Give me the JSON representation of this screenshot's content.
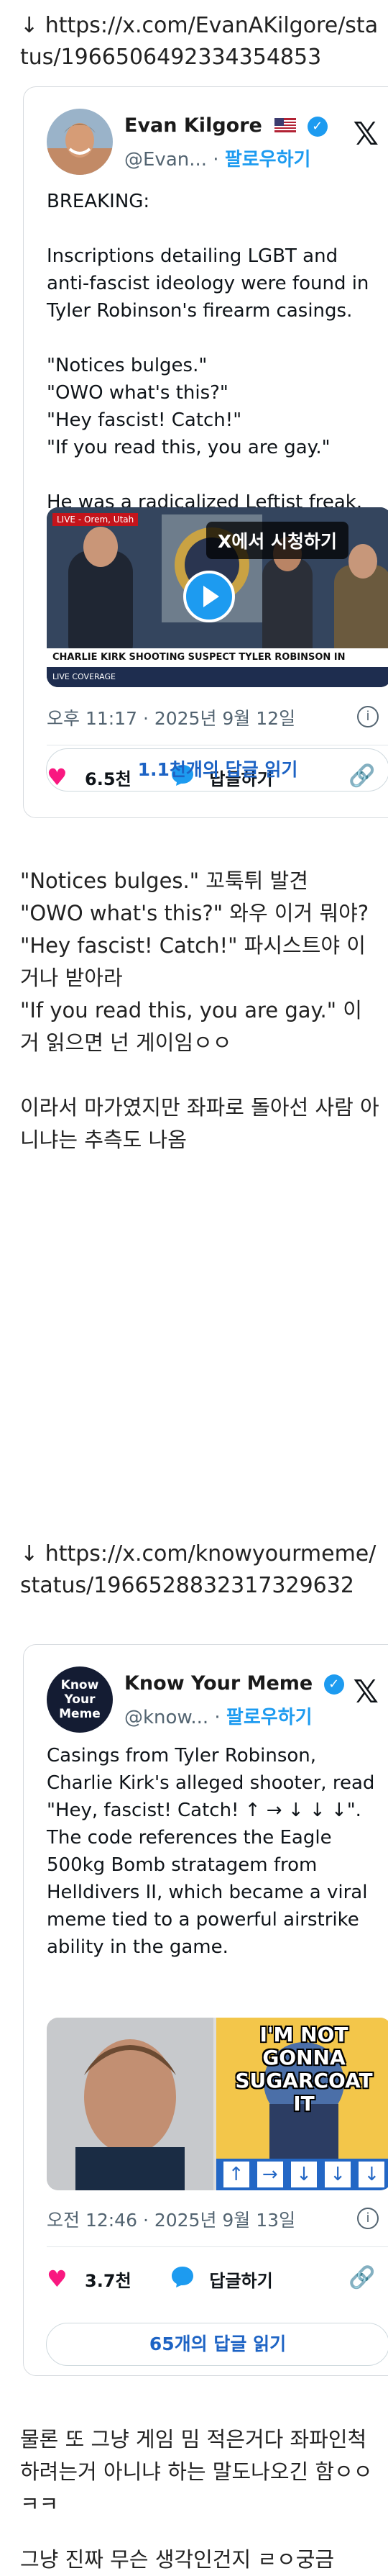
{
  "post1": {
    "link_arrow": "↓",
    "link_url": "https://x.com/EvanAKilgore/status/1966506492334354853",
    "tweet": {
      "name": "Evan Kilgore",
      "flag": "us-flag-icon",
      "handle": "@Evan...",
      "follow": "팔로우하기",
      "text": [
        "BREAKING:",
        "",
        "Inscriptions detailing LGBT and anti-fascist ideology were found in Tyler Robinson's firearm casings.",
        "",
        "\"Notices bulges.\"",
        "\"OWO what's this?\"",
        "\"Hey fascist! Catch!\"",
        "\"If you read this, you are gay.\"",
        "",
        "He was a radicalized Leftist freak."
      ],
      "video_overlay": "X에서 시청하기",
      "chyron_top": "LIVE - Orem, Utah",
      "chyron_main": "CHARLIE KIRK SHOOTING SUSPECT TYLER ROBINSON IN CUSTODY",
      "chyron_sub": "LIVE COVERAGE",
      "timestamp": "오후 11:17 · 2025년 9월 12일",
      "likes": "6.5천",
      "reply_label": "답글하기",
      "link_label": "링",
      "read_replies": "1.1천개의 답글 읽기"
    },
    "comment": [
      "\"Notices bulges.\" 꼬툭튀 발견",
      "\"OWO what's this?\" 와우 이거 뭐야?",
      "\"Hey fascist! Catch!\" 파시스트야 이거나 받아라",
      "\"If you read this, you are gay.\" 이거 읽으면 넌 게이임ㅇㅇ",
      "",
      "이라서 마가였지만 좌파로 돌아선 사람 아니냐는 추측도 나옴"
    ]
  },
  "post2": {
    "link_arrow": "↓",
    "link_url": "https://x.com/knowyourmeme/status/1966528832317329632",
    "tweet": {
      "name": "Know Your Meme",
      "avatar_text": "Know Your Meme",
      "handle": "@know...",
      "follow": "팔로우하기",
      "text": [
        "Casings from Tyler Robinson, Charlie Kirk's alleged shooter, read \"Hey, fascist! Catch! ↑ → ↓ ↓ ↓\". The code references the Eagle 500kg Bomb stratagem from Helldivers II, which became a viral meme tied to a powerful airstrike ability in the game."
      ],
      "meme_caption": "I'M NOT GONNA SUGARCOAT IT",
      "timestamp": "오전 12:46 · 2025년 9월 13일",
      "likes": "3.7천",
      "reply_label": "답글하기",
      "link_label": "링",
      "read_replies": "65개의 답글 읽기"
    },
    "comment": [
      "물론 또 그냥 게임 밈 적은거다 좌파인척 하려는거 아니냐 하는 말도나오긴 함ㅇㅇㅋㅋ",
      "",
      "그냥 진짜 무슨 생각인건지 ㄹㅇ궁금"
    ]
  },
  "colors": {
    "accent": "#1d9bf0",
    "like": "#f91880",
    "muted": "#536471"
  }
}
